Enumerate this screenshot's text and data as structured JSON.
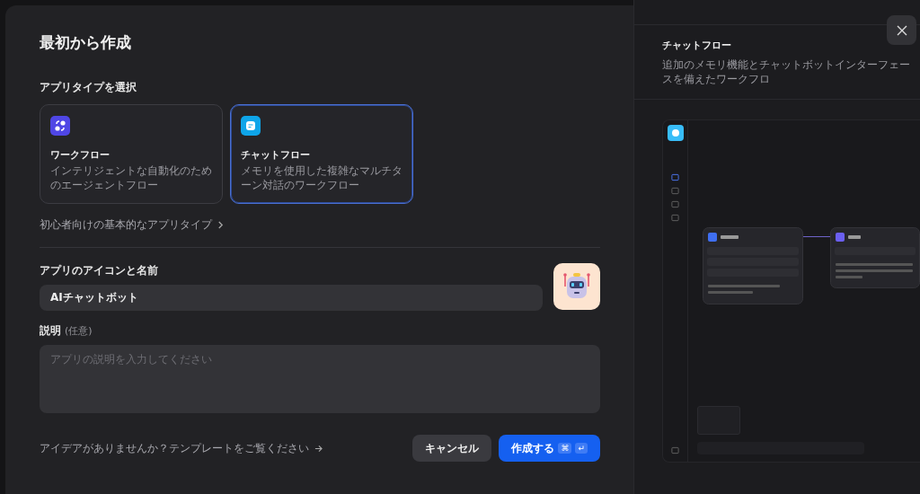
{
  "dialog": {
    "title": "最初から作成",
    "app_type_label": "アプリタイプを選択",
    "app_types": [
      {
        "kind": "workflow",
        "title": "ワークフロー",
        "description": "インテリジェントな自動化のためのエージェントフロー",
        "selected": false
      },
      {
        "kind": "chatflow",
        "title": "チャットフロー",
        "description": "メモリを使用した複雑なマルチターン対話のワークフロー",
        "selected": true
      }
    ],
    "beginner_link": "初心者向けの基本的なアプリタイプ",
    "name_label": "アプリのアイコンと名前",
    "name_value": "AIチャットボット",
    "description_label": "説明",
    "description_optional": "(任意)",
    "description_placeholder": "アプリの説明を入力してください",
    "template_link": "アイデアがありませんか？テンプレートをご覧ください",
    "cancel_button": "キャンセル",
    "create_button": "作成する",
    "shortcut_keys": [
      "⌘",
      "↵"
    ]
  },
  "preview": {
    "title": "チャットフロー",
    "description": "追加のメモリ機能とチャットボットインターフェースを備えたワークフロ"
  }
}
